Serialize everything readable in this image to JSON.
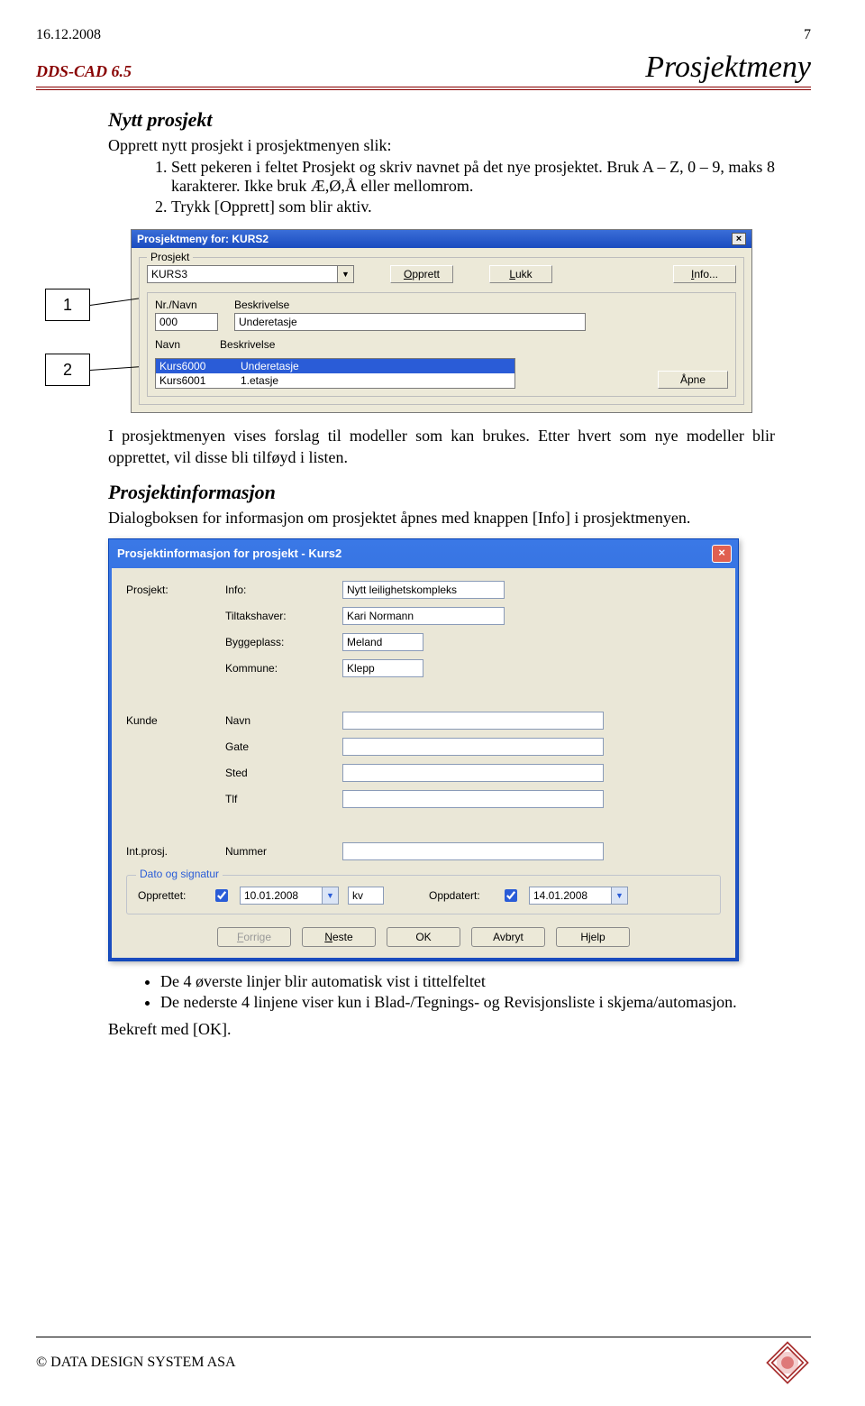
{
  "header": {
    "date": "16.12.2008",
    "pagenum": "7"
  },
  "subhead": {
    "app": "DDS-CAD 6.5",
    "title": "Prosjektmeny"
  },
  "section1": {
    "heading": "Nytt prosjekt",
    "intro": "Opprett nytt prosjekt i prosjektmenyen slik:",
    "steps": [
      "Sett pekeren i feltet Prosjekt og skriv navnet på det nye prosjektet. Bruk A – Z, 0 – 9, maks 8 karakterer. Ikke bruk Æ,Ø,Å eller mellomrom.",
      "Trykk [Opprett] som blir aktiv."
    ]
  },
  "callouts": {
    "c1": "1",
    "c2": "2"
  },
  "dialog1": {
    "title": "Prosjektmeny for: KURS2",
    "group1_label": "Prosjekt",
    "combo_value": "KURS3",
    "btn_opprett": "Opprett",
    "btn_lukk": "Lukk",
    "btn_info": "Info...",
    "nr_label": "Nr./Navn",
    "desc_label": "Beskrivelse",
    "nr_value": "000",
    "desc_value": "Underetasje",
    "navn_label": "Navn",
    "desc2_label": "Beskrivelse",
    "btn_apne": "Åpne",
    "rows": [
      {
        "c1": "Kurs6000",
        "c2": "Underetasje"
      },
      {
        "c1": "Kurs6001",
        "c2": "1.etasje"
      }
    ]
  },
  "midtext1": "I prosjektmenyen vises forslag til modeller som kan brukes. Etter hvert som nye modeller blir opprettet, vil disse bli tilføyd i listen.",
  "section2": {
    "heading": "Prosjektinformasjon",
    "text": "Dialogboksen for informasjon om prosjektet åpnes med knappen [Info] i prosjektmenyen."
  },
  "dialog2": {
    "title": "Prosjektinformasjon for prosjekt - Kurs2",
    "labels": {
      "prosjekt": "Prosjekt:",
      "info": "Info:",
      "tiltakshaver": "Tiltakshaver:",
      "byggeplass": "Byggeplass:",
      "kommune": "Kommune:",
      "kunde": "Kunde",
      "navn": "Navn",
      "gate": "Gate",
      "sted": "Sted",
      "tlf": "Tlf",
      "intprosj": "Int.prosj.",
      "nummer": "Nummer",
      "datesign": "Dato og signatur",
      "opprettet": "Opprettet:",
      "oppdatert": "Oppdatert:"
    },
    "values": {
      "info": "Nytt leilighetskompleks",
      "tiltakshaver": "Kari Normann",
      "byggeplass": "Meland",
      "kommune": "Klepp",
      "opprettet_date": "10.01.2008",
      "initials": "kv",
      "oppdatert_date": "14.01.2008"
    },
    "buttons": {
      "forrige": "Forrige",
      "neste": "Neste",
      "ok": "OK",
      "avbryt": "Avbryt",
      "hjelp": "Hjelp"
    }
  },
  "bullets": [
    "De 4 øverste linjer blir automatisk vist i tittelfeltet",
    "De nederste 4 linjene viser kun i Blad-/Tegnings- og Revisjonsliste i skjema/automasjon."
  ],
  "closing": "Bekreft med [OK].",
  "footer": {
    "copyright": "© DATA DESIGN SYSTEM ASA"
  }
}
